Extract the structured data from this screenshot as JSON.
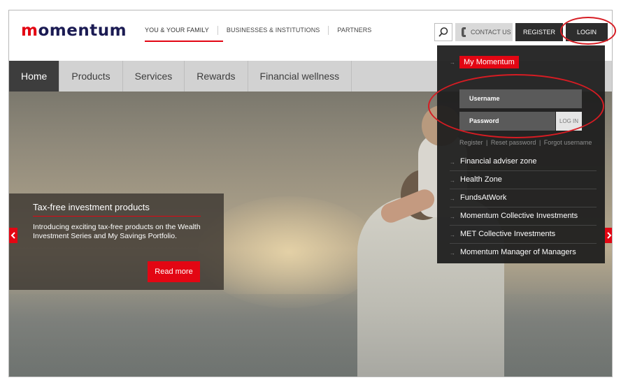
{
  "brand": {
    "logo_text": "momentum",
    "accent": "#e30613",
    "dark": "#2d2d2d"
  },
  "topnav": {
    "items": [
      "YOU & YOUR FAMILY",
      "BUSINESSES & INSTITUTIONS",
      "PARTNERS"
    ],
    "active": 0
  },
  "utility": {
    "search_icon": "search-icon",
    "contact_label": "CONTACT US",
    "register_label": "REGISTER",
    "login_label": "LOGIN"
  },
  "mainnav": {
    "items": [
      "Home",
      "Products",
      "Services",
      "Rewards",
      "Financial wellness"
    ],
    "active": 0
  },
  "promo": {
    "title": "Tax-free investment products",
    "text": "Introducing exciting tax-free products on the Wealth Investment Series and My Savings Portfolio.",
    "button": "Read more"
  },
  "dropdown": {
    "heading": "My Momentum",
    "username_label": "Username",
    "password_label": "Password",
    "login_button": "LOG IN",
    "links": [
      "Register",
      "Reset password",
      "Forgot username"
    ],
    "items": [
      "Financial adviser zone",
      "Health Zone",
      "FundsAtWork",
      "Momentum Collective Investments",
      "MET Collective Investments",
      "Momentum Manager of Managers"
    ]
  }
}
